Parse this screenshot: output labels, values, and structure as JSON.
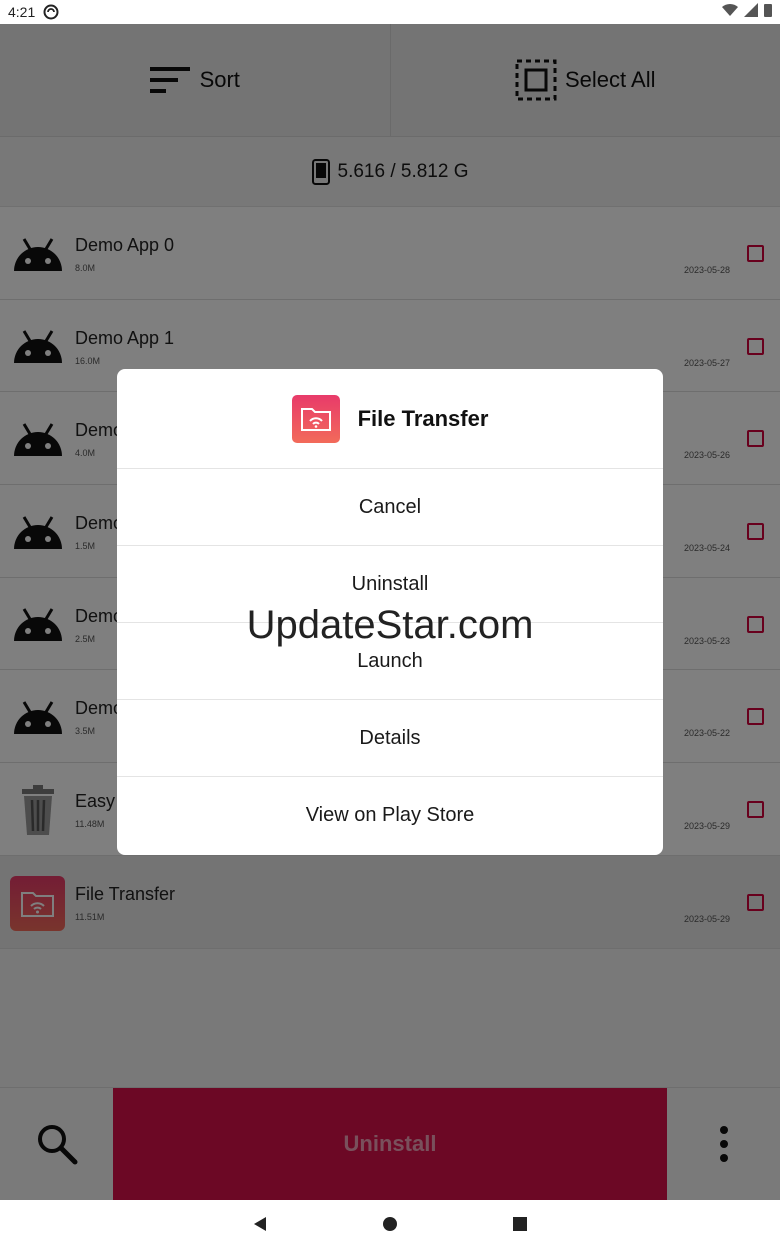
{
  "status_bar": {
    "time": "4:21"
  },
  "toolbar": {
    "sort_label": "Sort",
    "select_all_label": "Select All"
  },
  "storage": {
    "text": "5.616 / 5.812 G"
  },
  "apps": [
    {
      "name": "Demo App 0",
      "size": "8.0M",
      "date": "2023-05-28",
      "icon": "android-icon"
    },
    {
      "name": "Demo App 1",
      "size": "16.0M",
      "date": "2023-05-27",
      "icon": "android-icon"
    },
    {
      "name": "Demo",
      "size": "4.0M",
      "date": "2023-05-26",
      "icon": "android-icon"
    },
    {
      "name": "Demo",
      "size": "1.5M",
      "date": "2023-05-24",
      "icon": "android-icon"
    },
    {
      "name": "Demo",
      "size": "2.5M",
      "date": "2023-05-23",
      "icon": "android-icon"
    },
    {
      "name": "Demo",
      "size": "3.5M",
      "date": "2023-05-22",
      "icon": "android-icon"
    },
    {
      "name": "Easy",
      "size": "11.48M",
      "date": "2023-05-29",
      "icon": "trash-can-icon"
    },
    {
      "name": "File Transfer",
      "size": "11.51M",
      "date": "2023-05-29",
      "icon": "file-transfer-icon"
    }
  ],
  "bottom_bar": {
    "uninstall_label": "Uninstall"
  },
  "dialog": {
    "title": "File Transfer",
    "items": [
      "Cancel",
      "Uninstall",
      "Launch",
      "Details",
      "View on Play Store"
    ]
  },
  "watermark": "UpdateStar.com",
  "colors": {
    "accent": "#d9104a",
    "dialog_icon_top": "#e83a6a",
    "dialog_icon_bottom": "#f26a5a"
  }
}
